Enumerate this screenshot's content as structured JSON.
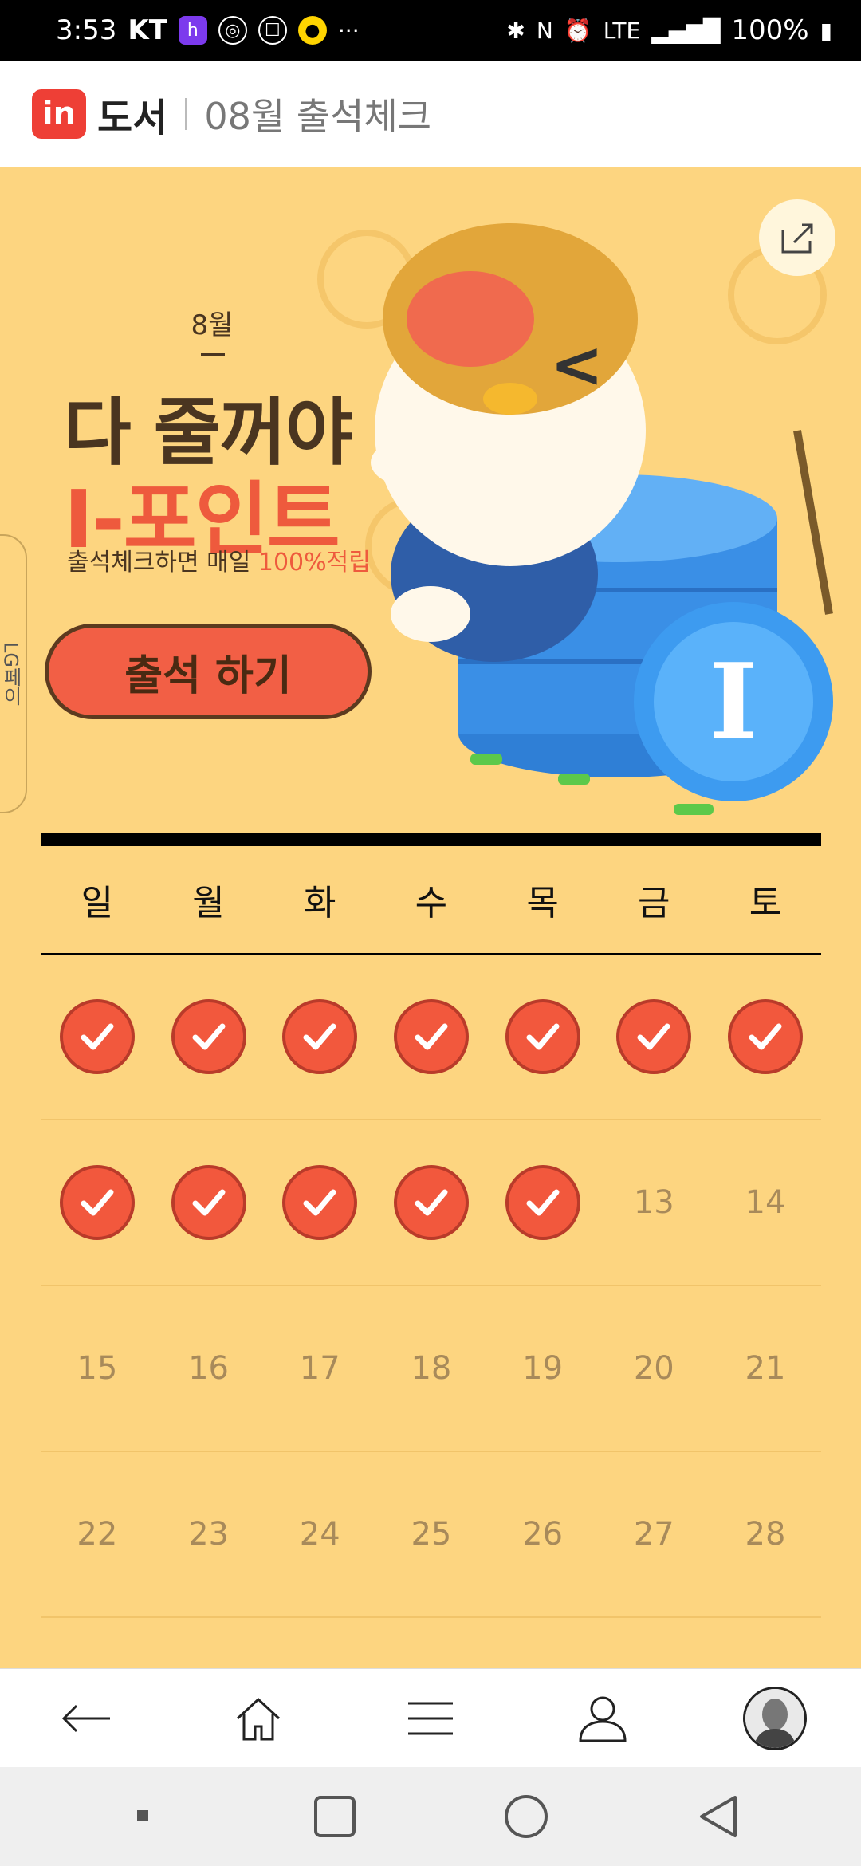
{
  "status_bar": {
    "time": "3:53",
    "carrier": "KT",
    "network": "LTE",
    "battery": "100%"
  },
  "header": {
    "logo_text": "in",
    "brand": "도서",
    "title": "08월 출석체크"
  },
  "banner": {
    "month": "8월",
    "headline": "다 줄꺼야",
    "point": "I-포인트",
    "subtitle_prefix": "출석체크하면 매일 ",
    "subtitle_highlight": "100%적립",
    "attend_button": "출석 하기",
    "side_tab": "LG페이",
    "accent_color": "#f2583d"
  },
  "calendar": {
    "weekdays": [
      "일",
      "월",
      "화",
      "수",
      "목",
      "금",
      "토"
    ],
    "rows": [
      [
        "check",
        "check",
        "check",
        "check",
        "check",
        "check",
        "check"
      ],
      [
        "check",
        "check",
        "check",
        "check",
        "check",
        "13",
        "14"
      ],
      [
        "15",
        "16",
        "17",
        "18",
        "19",
        "20",
        "21"
      ],
      [
        "22",
        "23",
        "24",
        "25",
        "26",
        "27",
        "28"
      ]
    ]
  },
  "bottom_nav": [
    "back",
    "home",
    "menu",
    "account",
    "profile"
  ]
}
